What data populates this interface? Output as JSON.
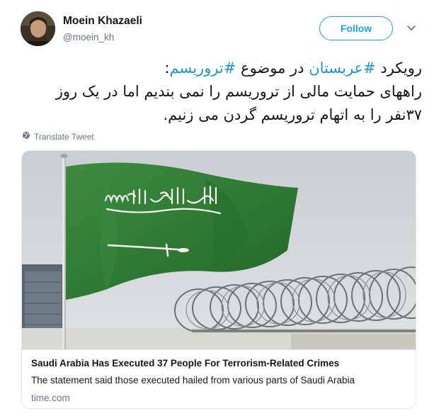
{
  "author": {
    "name": "Moein Khazaeli",
    "handle": "@moein_kh"
  },
  "follow_button": {
    "label": "Follow"
  },
  "tweet": {
    "line1_prefix": "رویکرد ",
    "hashtag1": "#عربستان",
    "line1_middle": " در موضوع ",
    "hashtag2": "#تروریسم",
    "line1_suffix": ":",
    "line2": "راههای حمایت مالی از تروریسم را نمی بندیم اما در یک روز",
    "line3": "۳۷نفر را به اتهام تروریسم گردن می زنیم."
  },
  "translate": {
    "label": "Translate Tweet",
    "icon": "globe-icon"
  },
  "card": {
    "title": "Saudi Arabia Has Executed 37 People For Terrorism-Related Crimes",
    "description": "The statement said those executed hailed from various parts of Saudi Arabia",
    "domain": "time.com",
    "image_icon": "saudi-flag-photo",
    "flag_color": "#2f7a34"
  },
  "colors": {
    "accent": "#1da1f2",
    "hashtag": "#1b95e0",
    "secondary_text": "#657786",
    "border": "#e1e8ed"
  }
}
